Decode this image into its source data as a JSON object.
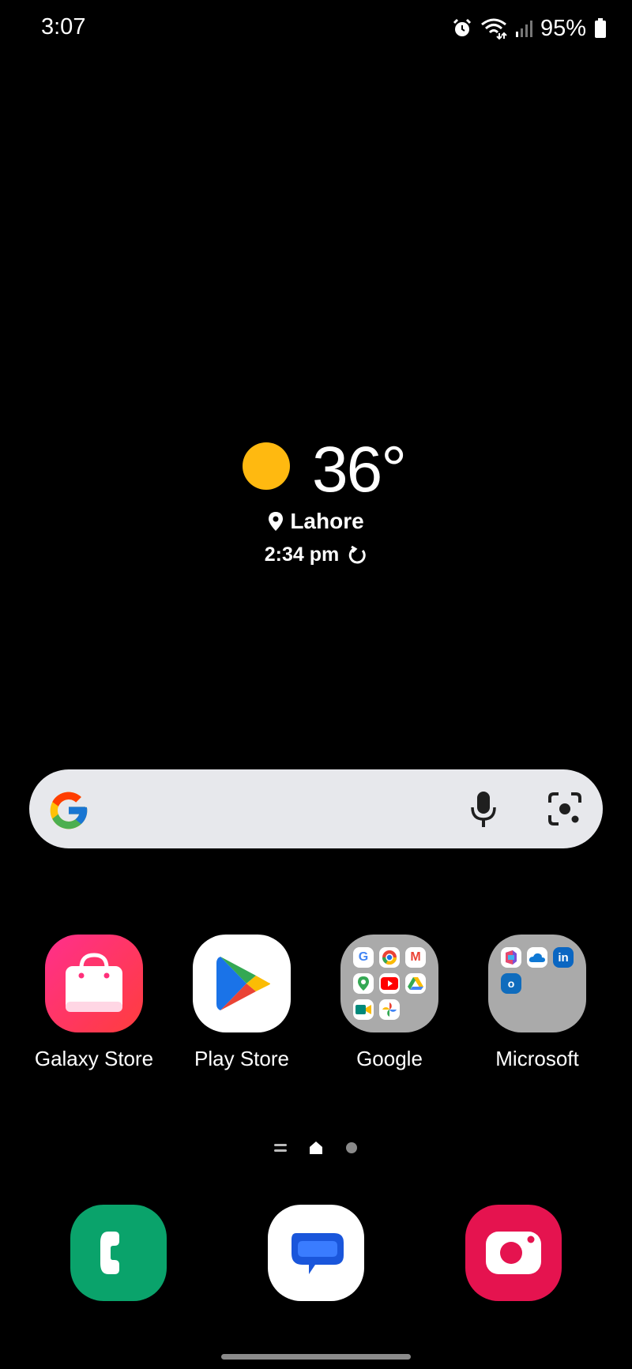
{
  "status_bar": {
    "time": "3:07",
    "battery": "95%",
    "icons": [
      "alarm-icon",
      "wifi-icon",
      "signal-icon",
      "battery-icon"
    ]
  },
  "weather": {
    "temperature": "36°",
    "location": "Lahore",
    "updated": "2:34 pm",
    "icon": "sunny",
    "sun_color": "#FFB910"
  },
  "search": {
    "icons": [
      "google-logo",
      "mic-icon",
      "lens-icon"
    ]
  },
  "apps": [
    {
      "label": "Galaxy Store",
      "icon": "galaxy-store-icon"
    },
    {
      "label": "Play Store",
      "icon": "play-store-icon"
    },
    {
      "label": "Google",
      "icon": "google-folder-icon"
    },
    {
      "label": "Microsoft",
      "icon": "microsoft-folder-icon"
    }
  ],
  "page_indicator": {
    "pages": 2,
    "current": "home"
  },
  "dock": [
    {
      "icon": "phone-icon",
      "color": "#0aa36b"
    },
    {
      "icon": "messages-icon",
      "color": "#ffffff"
    },
    {
      "icon": "camera-icon",
      "color": "#e5134f"
    }
  ]
}
